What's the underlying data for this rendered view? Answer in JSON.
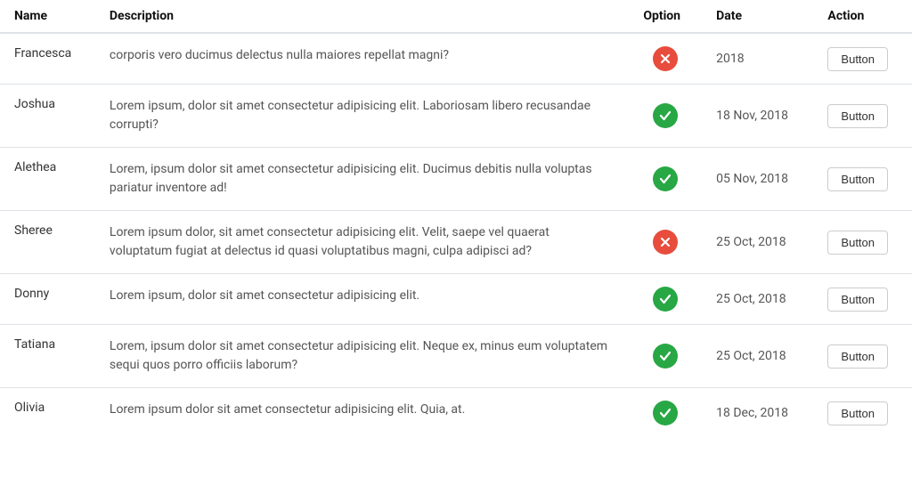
{
  "table": {
    "headers": {
      "name": "Name",
      "description": "Description",
      "option": "Option",
      "date": "Date",
      "action": "Action"
    },
    "rows": [
      {
        "name": "Francesca",
        "description": "corporis vero ducimus delectus nulla maiores repellat magni?",
        "option": "red",
        "date": "2018",
        "action": "Button"
      },
      {
        "name": "Joshua",
        "description": "Lorem ipsum, dolor sit amet consectetur adipisicing elit. Laboriosam libero recusandae corrupti?",
        "option": "green",
        "date": "18 Nov, 2018",
        "action": "Button"
      },
      {
        "name": "Alethea",
        "description": "Lorem, ipsum dolor sit amet consectetur adipisicing elit. Ducimus debitis nulla voluptas pariatur inventore ad!",
        "option": "green",
        "date": "05 Nov, 2018",
        "action": "Button"
      },
      {
        "name": "Sheree",
        "description": "Lorem ipsum dolor, sit amet consectetur adipisicing elit. Velit, saepe vel quaerat voluptatum fugiat at delectus id quasi voluptatibus magni, culpa adipisci ad?",
        "option": "red",
        "date": "25 Oct, 2018",
        "action": "Button"
      },
      {
        "name": "Donny",
        "description": "Lorem ipsum, dolor sit amet consectetur adipisicing elit.",
        "option": "green",
        "date": "25 Oct, 2018",
        "action": "Button"
      },
      {
        "name": "Tatiana",
        "description": "Lorem, ipsum dolor sit amet consectetur adipisicing elit. Neque ex, minus eum voluptatem sequi quos porro officiis laborum?",
        "option": "green",
        "date": "25 Oct, 2018",
        "action": "Button"
      },
      {
        "name": "Olivia",
        "description": "Lorem ipsum dolor sit amet consectetur adipisicing elit. Quia, at.",
        "option": "green",
        "date": "18 Dec, 2018",
        "action": "Button"
      }
    ]
  }
}
